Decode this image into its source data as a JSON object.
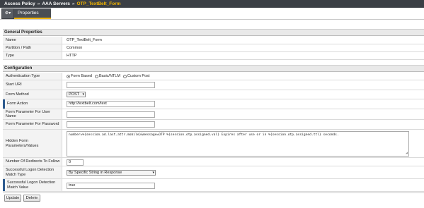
{
  "breadcrumb": {
    "items": [
      "Access Policy",
      "AAA Servers"
    ],
    "separator": "»",
    "current": "OTP_TextBelt_Form"
  },
  "tabs": {
    "menu_icon": "gear-icon",
    "menu_arrow": "▾",
    "properties": "Properties"
  },
  "general": {
    "title": "General Properties",
    "name_label": "Name",
    "name_value": "OTP_TextBelt_Form",
    "partition_label": "Partition / Path",
    "partition_value": "Common",
    "type_label": "Type",
    "type_value": "HTTP"
  },
  "config": {
    "title": "Configuration",
    "auth_type_label": "Authentication Type",
    "auth_options": [
      "Form Based",
      "Basic/NTLM",
      "Custom Post"
    ],
    "auth_selected": "Form Based",
    "start_uri_label": "Start URI",
    "start_uri_value": "",
    "form_method_label": "Form Method",
    "form_method_value": "POST",
    "form_action_label": "Form Action",
    "form_action_value": "http://textbelt.com/text",
    "param_user_label": "Form Parameter For User Name",
    "param_user_value": "",
    "param_pass_label": "Form Parameter For Password",
    "param_pass_value": "",
    "hidden_params_label": "Hidden Form Parameters/Values",
    "hidden_params_value": "number=%{session.ad.last.attr.mobile}&message=OTP %{session.otp.assigned.val} Expires after use or in %{session.otp.assigned.ttl} seconds.",
    "redirects_label": "Number Of Redirects To Follow",
    "redirects_value": "0",
    "logon_type_label": "Successful Logon Detection Match Type",
    "logon_type_value": "By Specific String in Response",
    "logon_value_label": "Successful Logon Detection Match Value",
    "logon_value_value": "true"
  },
  "buttons": {
    "update": "Update",
    "delete": "Delete"
  },
  "colors": {
    "topbar": "#3b3f45",
    "accent": "#f2b500",
    "required_marker": "#2c5a8f"
  }
}
